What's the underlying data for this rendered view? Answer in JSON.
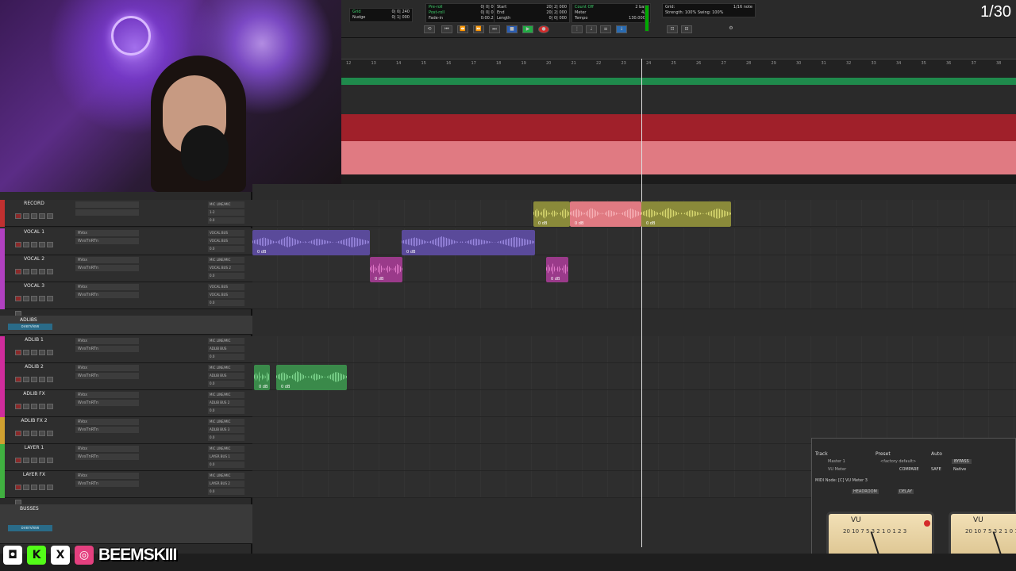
{
  "counter": "1/30",
  "transport": {
    "grid_label": "Grid:",
    "grid_value": "1/16 note",
    "strength_label": "Strength:",
    "strength_value": "100%",
    "swing_label": "Swing:",
    "swing_value": "100%",
    "count_off": "Count Off",
    "meter_label": "Meter",
    "meter_value": "4/4",
    "tempo_label": "Tempo",
    "tempo_value": "130.0000",
    "bars": "2 bars",
    "start_label": "Start",
    "end_label": "End",
    "length_label": "Length",
    "start_value": "20| 2| 000",
    "end_value": "20| 2| 000",
    "length_value": "0| 0| 000",
    "preroll": "Pre-roll",
    "postroll": "Post-roll",
    "fadein": "Fade-in",
    "preroll_value": "0| 0| 000",
    "postroll_value": "0| 0| 000",
    "fadein_value": "0:00.250",
    "grid_small": "Grid",
    "nudge_small": "Nudge",
    "grid_small_value": "0| 0| 240",
    "nudge_small_value": "0| 1| 000"
  },
  "ruler": {
    "bars": [
      "12",
      "13",
      "14",
      "15",
      "16",
      "17",
      "18",
      "19",
      "20",
      "21",
      "22",
      "23",
      "24",
      "25",
      "26",
      "27",
      "28",
      "29",
      "30",
      "31",
      "32",
      "33",
      "34",
      "35",
      "36",
      "37",
      "38"
    ]
  },
  "tracks": [
    {
      "name": "RECORD",
      "color": "#c03030",
      "io1": "MIC LINE/MIC",
      "io2": "1-2",
      "vol": "0.0",
      "ins1": "",
      "ins2": ""
    },
    {
      "name": "VOCAL 1",
      "color": "#b040c0",
      "io1": "VOCAL BUS",
      "io2": "VOCAL BUS",
      "vol": "0.0",
      "ins1": "RVox",
      "ins2": "WvsTnRTn"
    },
    {
      "name": "VOCAL 2",
      "color": "#b040c0",
      "io1": "MIC LINE/MIC",
      "io2": "VOCAL BUS 2",
      "vol": "0.0",
      "ins1": "RVox",
      "ins2": "WvsTnRTn"
    },
    {
      "name": "VOCAL 3",
      "color": "#b040c0",
      "io1": "VOCAL BUS",
      "io2": "VOCAL BUS",
      "vol": "0.0",
      "ins1": "RVox",
      "ins2": "WvsTnRTn"
    },
    {
      "name": "ADLIB 1",
      "color": "#d02c9c",
      "io1": "MIC LINE/MIC",
      "io2": "ADLIB BUS",
      "vol": "0.0",
      "ins1": "RVox",
      "ins2": "WvsTnRTn"
    },
    {
      "name": "ADLIB 2",
      "color": "#d02c9c",
      "io1": "MIC LINE/MIC",
      "io2": "ADLIB BUS",
      "vol": "0.0",
      "ins1": "RVox",
      "ins2": "WvsTnRTn"
    },
    {
      "name": "ADLIB FX",
      "color": "#d02c9c",
      "io1": "MIC LINE/MIC",
      "io2": "ADLIB BUS 2",
      "vol": "0.0",
      "ins1": "RVox",
      "ins2": "WvsTnRTn"
    },
    {
      "name": "ADLIB FX 2",
      "color": "#d0a030",
      "io1": "MIC LINE/MIC",
      "io2": "ADLIB BUS 3",
      "vol": "0.0",
      "ins1": "RVox",
      "ins2": "WvsTnRTn"
    },
    {
      "name": "LAYER 1",
      "color": "#40b040",
      "io1": "MIC LINE/MIC",
      "io2": "LAYER BUS 1",
      "vol": "0.0",
      "ins1": "RVox",
      "ins2": "WvsTnRTn"
    },
    {
      "name": "LAYER FX",
      "color": "#40b040",
      "io1": "MIC LINE/MIC",
      "io2": "LAYER BUS 2",
      "vol": "0.0",
      "ins1": "RVox",
      "ins2": "WvsTnRTn"
    }
  ],
  "folders": {
    "adlibs": "ADLIBS",
    "busses": "BUSSES",
    "overview": "overview"
  },
  "clips": {
    "db": "0 dB"
  },
  "plugin": {
    "track_label": "Track",
    "preset_label": "Preset",
    "auto_label": "Auto",
    "track_name": "Master 1",
    "preset_name": "<factory default>",
    "plugin_name": "VU Meter",
    "compare": "COMPARE",
    "safe": "SAFE",
    "bypass": "BYPASS",
    "native": "Native",
    "midi_node": "MIDI Node: [C] VU Meter 3",
    "headroom": "HEADROOM",
    "delay": "DELAY",
    "vu_label": "VU",
    "vu_scale": "20 10 7 5 3 2 1 0 1 2 3"
  },
  "social": {
    "handle": "BEEMSKIII"
  }
}
